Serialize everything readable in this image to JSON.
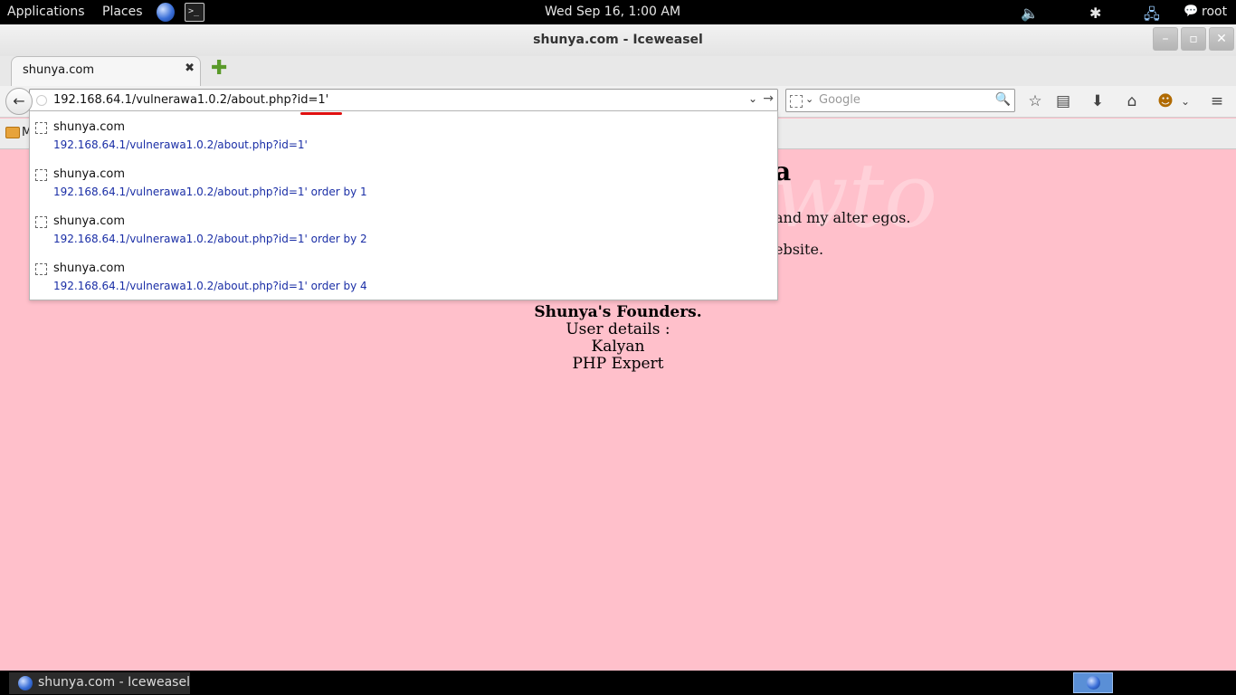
{
  "topbar": {
    "applications": "Applications",
    "places": "Places",
    "clock": "Wed Sep 16,  1:00 AM",
    "user": "root"
  },
  "window": {
    "title": "shunya.com - Iceweasel"
  },
  "tab": {
    "title": "shunya.com"
  },
  "url_bar": {
    "value": "192.168.64.1/vulnerawa1.0.2/about.php?id=1'"
  },
  "search": {
    "placeholder": "Google"
  },
  "autocomplete": {
    "items": [
      {
        "title": "shunya.com",
        "url": "192.168.64.1/vulnerawa1.0.2/about.php?id=1'"
      },
      {
        "title": "shunya.com",
        "url": "192.168.64.1/vulnerawa1.0.2/about.php?id=1' order by 1"
      },
      {
        "title": "shunya.com",
        "url": "192.168.64.1/vulnerawa1.0.2/about.php?id=1' order by 2"
      },
      {
        "title": "shunya.com",
        "url": "192.168.64.1/vulnerawa1.0.2/about.php?id=1' order by 4"
      }
    ]
  },
  "bookmarks": {
    "partial_label": "M"
  },
  "page": {
    "watermark": "@kanishkashowto",
    "heading_partial": "a",
    "para1_partial": "and my alter egos.",
    "para2_partial": "ebsite.",
    "founders_title": "Shunya's Founders.",
    "user_details": "User details :",
    "name": "Kalyan",
    "role": "PHP Expert"
  },
  "taskbar": {
    "item": "shunya.com - Iceweasel"
  },
  "colors": {
    "page_background": "#ffc0cb",
    "link_blue": "#1a2ea6",
    "annotation_red": "#e01010"
  }
}
